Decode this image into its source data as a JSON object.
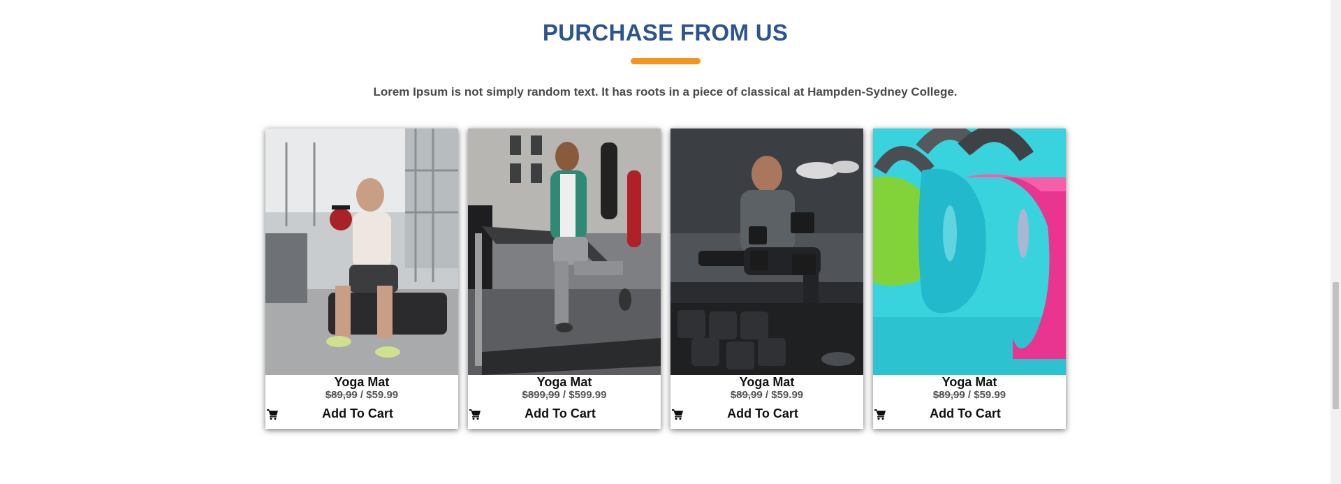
{
  "section": {
    "title": "PURCHASE FROM US",
    "subtitle": "Lorem Ipsum is not simply random text. It has roots in a piece of classical at Hampden-Sydney College."
  },
  "colors": {
    "title": "#2d5391",
    "accent": "#f7941d"
  },
  "products": [
    {
      "name": "Yoga Mat",
      "old_price": "$89,99",
      "separator": " / ",
      "new_price": "$59.99",
      "cart_label": "Add To Cart",
      "cart_icon": "shopping-cart-icon",
      "image": "man with kettlebell in gym"
    },
    {
      "name": "Yoga Mat",
      "old_price": "$899,99",
      "separator": " / ",
      "new_price": "$599.99",
      "cart_label": "Add To Cart",
      "cart_icon": "shopping-cart-icon",
      "image": "man running on treadmill"
    },
    {
      "name": "Yoga Mat",
      "old_price": "$89,99",
      "separator": " / ",
      "new_price": "$59.99",
      "cart_label": "Add To Cart",
      "cart_icon": "shopping-cart-icon",
      "image": "man lifting dumbbells"
    },
    {
      "name": "Yoga Mat",
      "old_price": "$89,99",
      "separator": " / ",
      "new_price": "$59.99",
      "cart_label": "Add To Cart",
      "cart_icon": "shopping-cart-icon",
      "image": "colorful kettlebells"
    }
  ]
}
